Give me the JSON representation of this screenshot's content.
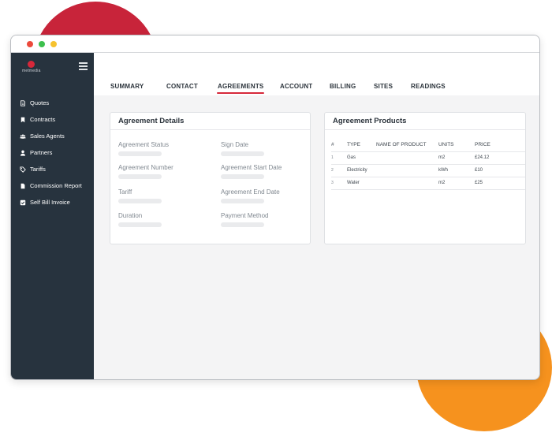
{
  "window_controls": {
    "close_color": "#ec4a3b",
    "minimize_color": "#3dc04d",
    "zoom_color": "#f6c22e"
  },
  "brand": {
    "logo_text": "metmedia"
  },
  "sidebar": {
    "items": [
      {
        "label": "Quotes",
        "icon": "document-icon"
      },
      {
        "label": "Contracts",
        "icon": "bookmark-icon"
      },
      {
        "label": "Sales Agents",
        "icon": "group-icon"
      },
      {
        "label": "Partners",
        "icon": "handshake-icon"
      },
      {
        "label": "Tariffs",
        "icon": "tag-icon"
      },
      {
        "label": "Commission Report",
        "icon": "file-icon"
      },
      {
        "label": "Self Bill Invoice",
        "icon": "checkbox-icon"
      }
    ]
  },
  "tabs": [
    {
      "label": "SUMMARY"
    },
    {
      "label": "CONTACT"
    },
    {
      "label": "AGREEMENTS",
      "active": true
    },
    {
      "label": "ACCOUNT"
    },
    {
      "label": "BILLING"
    },
    {
      "label": "SITES"
    },
    {
      "label": "READINGS"
    }
  ],
  "agreement_details": {
    "title": "Agreement Details",
    "fields": [
      {
        "label": "Agreement Status"
      },
      {
        "label": "Sign Date"
      },
      {
        "label": "Agreement Number"
      },
      {
        "label": "Agreement Start Date"
      },
      {
        "label": "Tariff"
      },
      {
        "label": "Agreement End Date"
      },
      {
        "label": "Duration"
      },
      {
        "label": "Payment Method"
      }
    ]
  },
  "agreement_products": {
    "title": "Agreement Products",
    "columns": [
      "#",
      "TYPE",
      "NAME OF PRODUCT",
      "UNITS",
      "PRICE"
    ],
    "rows": [
      {
        "index": "1",
        "type": "Gas",
        "name": "",
        "units": "m2",
        "price": "£24.12"
      },
      {
        "index": "2",
        "type": "Electricity",
        "name": "",
        "units": "kWh",
        "price": "£10"
      },
      {
        "index": "3",
        "type": "Water",
        "name": "",
        "units": "m2",
        "price": "£25"
      }
    ]
  },
  "colors": {
    "sidebar_bg": "#27333e",
    "accent_red": "#d6283a",
    "blob_red": "#c8243a",
    "blob_orange": "#f6921e"
  }
}
